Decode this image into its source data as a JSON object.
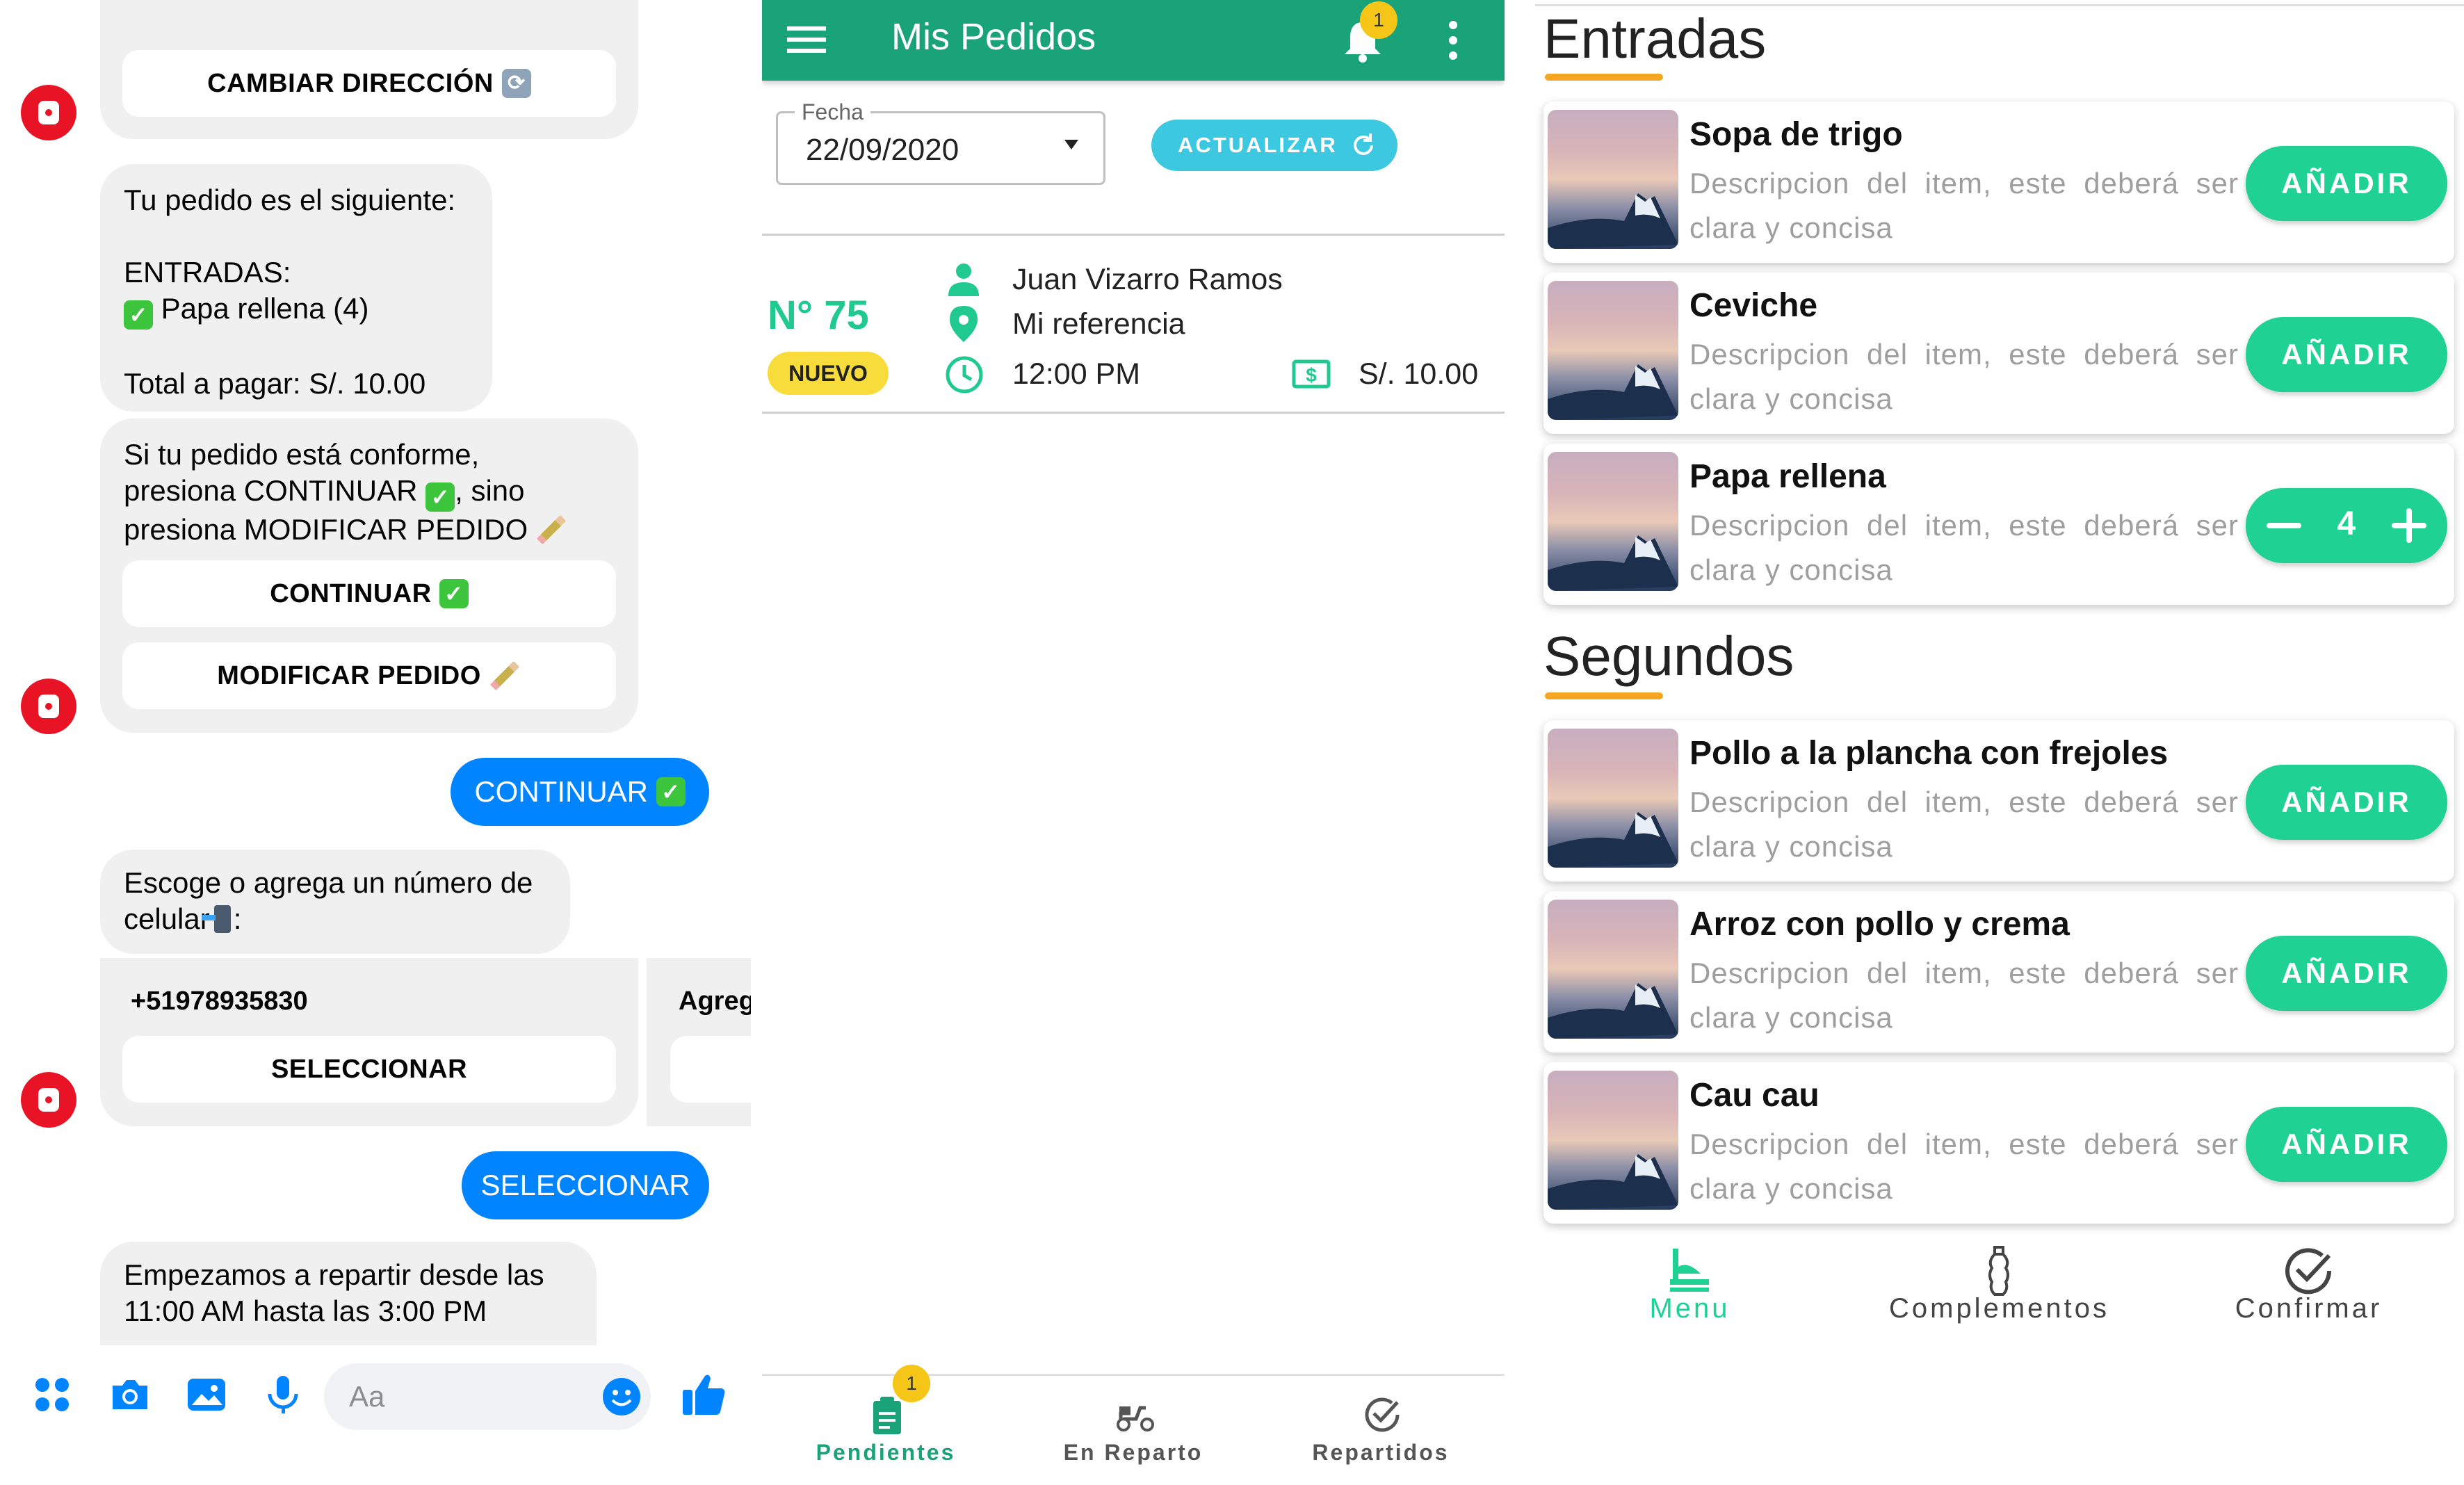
{
  "colors": {
    "messenger_blue": "#0084ff",
    "app_green": "#1aa279",
    "accent_green": "#1fd193",
    "badge_yellow": "#f7dc3c",
    "section_orange": "#f5a623",
    "info_cyan": "#3cc8e0"
  },
  "chat": {
    "quick_replies": {
      "change_address": "CAMBIAR DIRECCIÓN",
      "continue": "CONTINUAR",
      "modify": "MODIFICAR PEDIDO",
      "select": "SELECCIONAR"
    },
    "messages": {
      "order_summary": "Tu pedido es el siguiente:\n\nENTRADAS:",
      "order_item": "Papa rellena (4)",
      "order_total": "Total a pagar: S/. 10.00",
      "confirm_prompt_1": "Si tu pedido está conforme,",
      "confirm_prompt_2": "presiona CONTINUAR",
      "confirm_prompt_3": ", sino",
      "confirm_prompt_4": "presiona MODIFICAR PEDIDO",
      "phone_prompt_1": "Escoge o agrega un número de",
      "phone_prompt_2": "celular",
      "phone_prompt_3": ":",
      "phone_number": "+51978935830",
      "add_card_label": "Agreg",
      "delivery_info": "Empezamos a repartir desde las\n11:00 AM hasta las 3:00 PM"
    },
    "user_replies": {
      "continue": "CONTINUAR",
      "select": "SELECCIONAR"
    },
    "composer": {
      "placeholder": "Aa"
    },
    "icons": [
      "apps-icon",
      "camera-icon",
      "gallery-icon",
      "microphone-icon",
      "emoji-icon",
      "thumbs-up-icon"
    ]
  },
  "orders": {
    "title": "Mis Pedidos",
    "notification_count": "1",
    "date_label": "Fecha",
    "date_value": "22/09/2020",
    "refresh_button": "ACTUALIZAR",
    "order": {
      "number": "N° 75",
      "status": "NUEVO",
      "customer": "Juan Vizarro Ramos",
      "reference": "Mi referencia",
      "time": "12:00 PM",
      "amount": "S/. 10.00"
    },
    "bottom_nav": [
      {
        "label": "Pendientes",
        "badge": "1",
        "active": true
      },
      {
        "label": "En Reparto",
        "active": false
      },
      {
        "label": "Repartidos",
        "active": false
      }
    ]
  },
  "menu": {
    "sections": [
      {
        "title": "Entradas",
        "items": [
          {
            "name": "Sopa de trigo",
            "desc": "Descripcion del item, este deberá ser clara y concisa",
            "action": "AÑADIR"
          },
          {
            "name": "Ceviche",
            "desc": "Descripcion del item, este deberá ser clara y concisa",
            "action": "AÑADIR"
          },
          {
            "name": "Papa rellena",
            "desc": "Descripcion del item, este deberá ser clara y concisa",
            "quantity": "4"
          }
        ]
      },
      {
        "title": "Segundos",
        "items": [
          {
            "name": "Pollo a la plancha con frejoles",
            "desc": "Descripcion del item, este deberá ser clara y concisa",
            "action": "AÑADIR"
          },
          {
            "name": "Arroz con pollo y crema",
            "desc": "Descripcion del item, este deberá ser clara y concisa",
            "action": "AÑADIR"
          },
          {
            "name": "Cau cau",
            "desc": "Descripcion del item, este deberá ser clara y concisa",
            "action": "AÑADIR"
          }
        ]
      }
    ],
    "bottom_nav": [
      {
        "label": "Menu",
        "active": true
      },
      {
        "label": "Complementos",
        "active": false
      },
      {
        "label": "Confirmar",
        "active": false
      }
    ]
  }
}
